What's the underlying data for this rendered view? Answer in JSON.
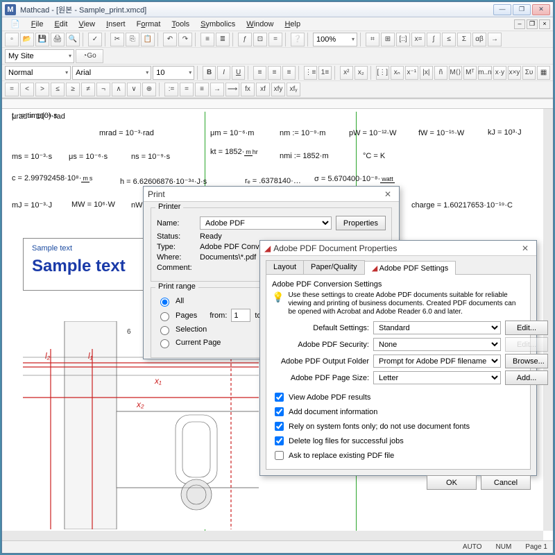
{
  "title": "Mathcad - [원본 - Sample_print.xmcd]",
  "menus": [
    "File",
    "Edit",
    "View",
    "Insert",
    "Format",
    "Tools",
    "Symbolics",
    "Window",
    "Help"
  ],
  "combos": {
    "site": "My Site",
    "go": "Go",
    "style": "Normal",
    "font": "Arial",
    "size": "10",
    "zoom": "100%"
  },
  "equations": {
    "t1": "t₁ := time(0)·s",
    "murad": "μrad = 10⁻⁶·rad",
    "mrad": "mrad = 10⁻³·rad",
    "mum": "μm = 10⁻⁶·m",
    "nm": "nm := 10⁻⁹·m",
    "pw": "pW = 10⁻¹²·W",
    "fw": "fW = 10⁻¹⁵·W",
    "kj": "kJ = 10³·J",
    "ms": "ms = 10⁻³·s",
    "mus": "μs = 10⁻⁶·s",
    "ns": "ns = 10⁻⁹·s",
    "kt": "kt = 1852·",
    "kt_unit_top": "m",
    "kt_unit_bot": "hr",
    "nmi": "nmi := 1852·m",
    "degC": "°C = K",
    "c": "c = 2.99792458·10⁸·",
    "c_unit_top": "m",
    "c_unit_bot": "s",
    "h": "h = 6.62606876·10⁻³⁴·J·s",
    "re": "rₑ = .6378140·…",
    "sig": "σ = 5.670400·10⁻⁸·",
    "sig_unit": "watt",
    "mJ": "mJ = 10⁻³·J",
    "MW": "MW = 10⁶·W",
    "nW": "nW = 10⁻⁹·W",
    "chg": "charge = 1.60217653·10⁻¹⁹·C"
  },
  "sample": {
    "lbl": "Sample text",
    "big": "Sample text"
  },
  "drawing_labels": {
    "l2": "l₂",
    "l1": "l₁",
    "x1": "x₁",
    "x2": "x₂",
    "six": "6"
  },
  "print_dlg": {
    "title": "Print",
    "printer_grp": "Printer",
    "name_lbl": "Name:",
    "name_val": "Adobe PDF",
    "props_btn": "Properties",
    "status_lbl": "Status:",
    "status_val": "Ready",
    "type_lbl": "Type:",
    "type_val": "Adobe PDF Converte",
    "where_lbl": "Where:",
    "where_val": "Documents\\*.pdf",
    "comment_lbl": "Comment:",
    "range_grp": "Print range",
    "all": "All",
    "pages": "Pages",
    "from_lbl": "from:",
    "from_val": "1",
    "to_lbl": "to:",
    "sel": "Selection",
    "cur": "Current Page"
  },
  "pdf_dlg": {
    "title": "Adobe PDF Document Properties",
    "tab1": "Layout",
    "tab2": "Paper/Quality",
    "tab3": "Adobe PDF Settings",
    "hdr": "Adobe PDF Conversion Settings",
    "note": "Use these settings to create Adobe PDF documents suitable for reliable viewing and printing of business documents.  Created PDF documents can be opened with Acrobat and Adobe Reader 6.0 and later.",
    "def_lbl": "Default Settings:",
    "def_val": "Standard",
    "edit_btn": "Edit...",
    "sec_lbl": "Adobe PDF Security:",
    "sec_val": "None",
    "out_lbl": "Adobe PDF Output Folder",
    "out_val": "Prompt for Adobe PDF filename",
    "browse_btn": "Browse...",
    "page_lbl": "Adobe PDF Page Size:",
    "page_val": "Letter",
    "add_btn": "Add...",
    "cb1": "View Adobe PDF results",
    "cb2": "Add document information",
    "cb3": "Rely on system fonts only; do not use document fonts",
    "cb4": "Delete log files for successful jobs",
    "cb5": "Ask to replace existing PDF file",
    "ok": "OK",
    "cancel": "Cancel"
  },
  "status": {
    "auto": "AUTO",
    "num": "NUM",
    "page": "Page 1"
  }
}
